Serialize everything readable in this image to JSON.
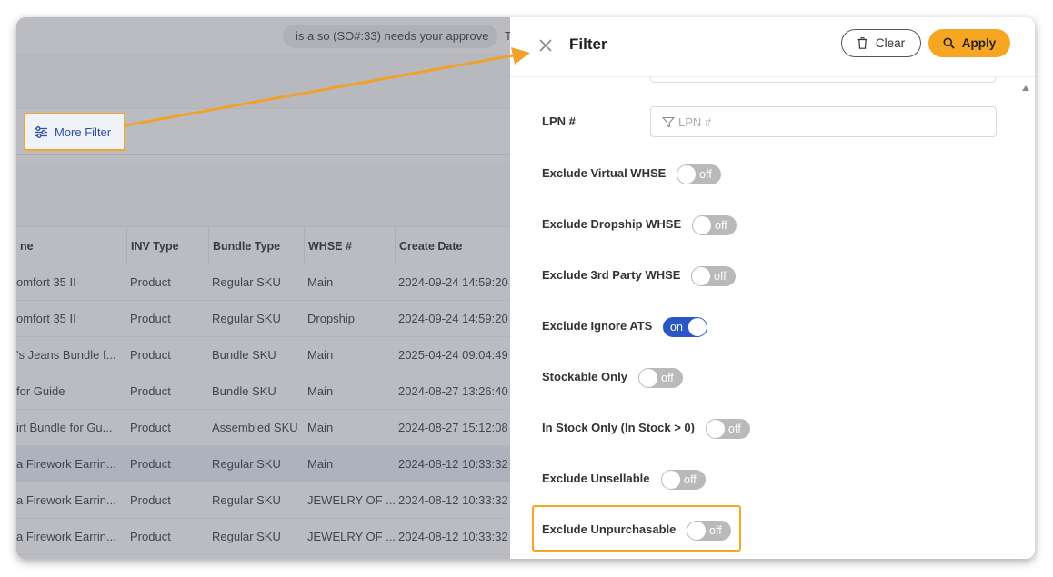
{
  "notification": {
    "text": "is a so (SO#:33) needs your approve",
    "overflow": "T"
  },
  "more_filter": {
    "label": "More Filter"
  },
  "table": {
    "columns": [
      "ne",
      "INV Type",
      "Bundle Type",
      "WHSE #",
      "Create Date"
    ],
    "rows": [
      [
        "omfort 35 II",
        "Product",
        "Regular SKU",
        "Main",
        "2024-09-24 14:59:20"
      ],
      [
        "omfort 35 II",
        "Product",
        "Regular SKU",
        "Dropship",
        "2024-09-24 14:59:20"
      ],
      [
        "'s Jeans Bundle f...",
        "Product",
        "Bundle SKU",
        "Main",
        "2025-04-24 09:04:49"
      ],
      [
        "for Guide",
        "Product",
        "Bundle SKU",
        "Main",
        "2024-08-27 13:26:40"
      ],
      [
        "irt Bundle for Gu...",
        "Product",
        "Assembled SKU",
        "Main",
        "2024-08-27 15:12:08"
      ],
      [
        "a Firework Earrin...",
        "Product",
        "Regular SKU",
        "Main",
        "2024-08-12 10:33:32"
      ],
      [
        "a Firework Earrin...",
        "Product",
        "Regular SKU",
        "JEWELRY OF ...",
        "2024-08-12 10:33:32"
      ],
      [
        "a Firework Earrin...",
        "Product",
        "Regular SKU",
        "JEWELRY OF ...",
        "2024-08-12 10:33:32"
      ]
    ],
    "selected_row_index": 5
  },
  "drawer": {
    "title": "Filter",
    "clear_label": "Clear",
    "apply_label": "Apply",
    "lpn": {
      "label": "LPN #",
      "placeholder": "LPN #"
    },
    "toggles": [
      {
        "label": "Exclude Virtual WHSE",
        "state": "off"
      },
      {
        "label": "Exclude Dropship WHSE",
        "state": "off"
      },
      {
        "label": "Exclude 3rd Party WHSE",
        "state": "off"
      },
      {
        "label": "Exclude Ignore ATS",
        "state": "on"
      },
      {
        "label": "Stockable Only",
        "state": "off"
      },
      {
        "label": "In Stock Only (In Stock > 0)",
        "state": "off"
      },
      {
        "label": "Exclude Unsellable",
        "state": "off"
      },
      {
        "label": "Exclude Unpurchasable",
        "state": "off"
      }
    ]
  },
  "icons": {
    "close": "close-icon",
    "trash": "trash-icon",
    "search": "search-icon",
    "filter": "filter-icon",
    "sliders": "sliders-icon",
    "scroll_up": "caret-up-icon"
  },
  "colors": {
    "accent": "#f6a623",
    "toggle_on": "#2b56c8",
    "toggle_off": "#b9b9b9",
    "link": "#2a4aa8"
  }
}
